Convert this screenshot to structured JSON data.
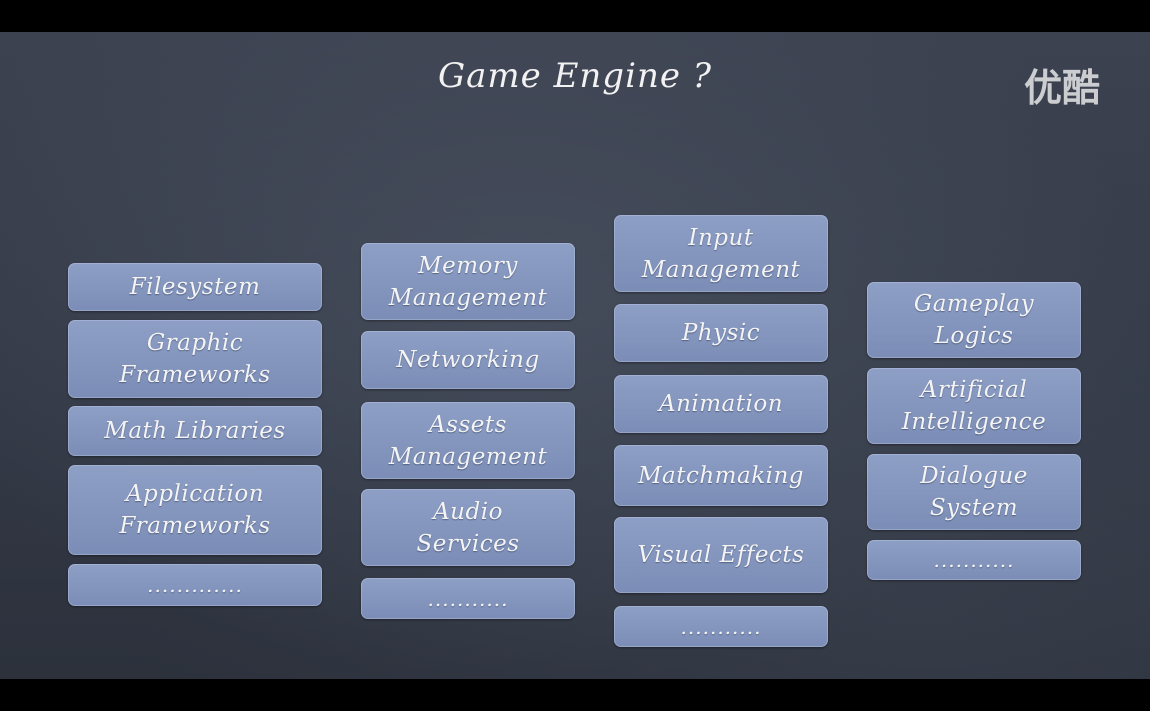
{
  "slide": {
    "title": "Game Engine ?",
    "watermark": "优酷"
  },
  "columns": [
    {
      "items": [
        "Filesystem",
        "Graphic\nFrameworks",
        "Math Libraries",
        "Application\nFrameworks",
        "............."
      ]
    },
    {
      "items": [
        "Memory\nManagement",
        "Networking",
        "Assets\nManagement",
        "Audio\nServices",
        "..........."
      ]
    },
    {
      "items": [
        "Input\nManagement",
        "Physic",
        "Animation",
        "Matchmaking",
        "Visual Effects",
        "..........."
      ]
    },
    {
      "items": [
        "Gameplay\nLogics",
        "Artificial\nIntelligence",
        "Dialogue\nSystem",
        "..........."
      ]
    }
  ]
}
